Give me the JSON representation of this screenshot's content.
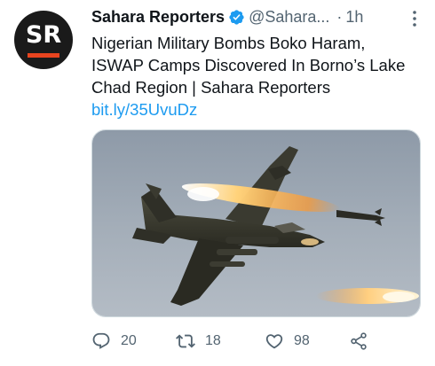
{
  "tweet": {
    "avatar_text": "SR",
    "display_name": "Sahara Reporters",
    "handle": "@Sahara...",
    "separator": "·",
    "time": "1h",
    "text": "Nigerian Military Bombs Boko Haram, ISWAP Camps Discovered In Borno’s Lake Chad Region | Sahara Reporters",
    "link": "bit.ly/35UvuDz",
    "replies": "20",
    "retweets": "18",
    "likes": "98"
  },
  "colors": {
    "link": "#1d9bf0",
    "secondary_text": "#536471",
    "verified": "#1d9bf0",
    "avatar_bg": "#1a1a1a",
    "avatar_accent": "#e8441f"
  },
  "icons": {
    "verified": "verified-badge-icon",
    "more": "more-vertical-icon",
    "reply": "reply-icon",
    "retweet": "retweet-icon",
    "like": "heart-icon",
    "share": "share-icon"
  }
}
